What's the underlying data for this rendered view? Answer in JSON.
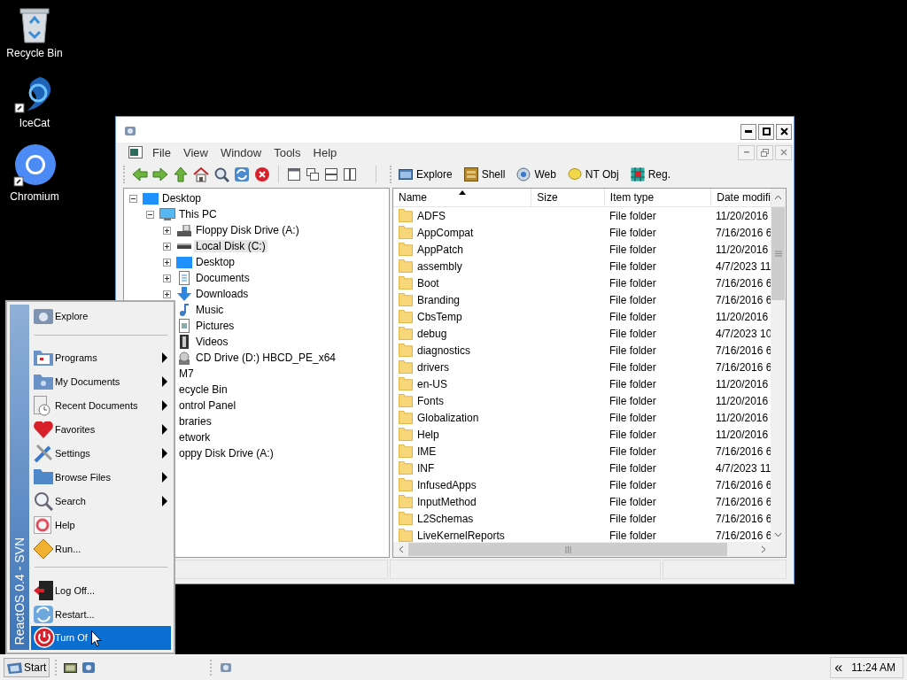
{
  "desktop_icons": [
    {
      "label": "Recycle Bin",
      "kind": "recycle"
    },
    {
      "label": "IceCat",
      "kind": "icecat"
    },
    {
      "label": "Chromium",
      "kind": "chromium"
    }
  ],
  "window": {
    "menu": [
      "File",
      "View",
      "Window",
      "Tools",
      "Help"
    ],
    "toolbar_buttons": [
      {
        "label": "Explore",
        "kind": "folder"
      },
      {
        "label": "Shell",
        "kind": "shell"
      },
      {
        "label": "Web",
        "kind": "web"
      },
      {
        "label": "NT Obj",
        "kind": "ntobj"
      },
      {
        "label": "Reg.",
        "kind": "registry"
      }
    ],
    "tree": {
      "items": [
        {
          "label": "Desktop",
          "kind": "desktop",
          "expanded": true,
          "selected": false,
          "children": [
            {
              "label": "This PC",
              "kind": "pc",
              "expanded": true,
              "selected": false,
              "children": [
                {
                  "label": "Floppy Disk Drive (A:)",
                  "kind": "floppy",
                  "expanded": false,
                  "selected": false
                },
                {
                  "label": "Local Disk (C:)",
                  "kind": "disk",
                  "expanded": false,
                  "selected": true
                },
                {
                  "label": "Desktop",
                  "kind": "desktop",
                  "expanded": false,
                  "selected": false
                },
                {
                  "label": "Documents",
                  "kind": "documents",
                  "expanded": false,
                  "selected": false
                },
                {
                  "label": "Downloads",
                  "kind": "downloads",
                  "expanded": false,
                  "selected": false
                },
                {
                  "label": "Music",
                  "kind": "music",
                  "selected": false
                },
                {
                  "label": "Pictures",
                  "kind": "pictures",
                  "selected": false
                },
                {
                  "label": "Videos",
                  "kind": "videos",
                  "selected": false
                },
                {
                  "label": "CD Drive (D:) HBCD_PE_x64",
                  "kind": "cd",
                  "selected": false
                }
              ]
            },
            {
              "label": "M7",
              "selected": false
            },
            {
              "label": "ecycle Bin",
              "selected": false
            },
            {
              "label": "ontrol Panel",
              "selected": false
            },
            {
              "label": "braries",
              "selected": false
            },
            {
              "label": "etwork",
              "selected": false
            },
            {
              "label": "oppy Disk Drive (A:)",
              "selected": false
            }
          ]
        }
      ]
    },
    "list": {
      "columns": [
        {
          "label": "Name",
          "sorted": true
        },
        {
          "label": "Size",
          "sorted": false
        },
        {
          "label": "Item type",
          "sorted": false
        },
        {
          "label": "Date modifi",
          "sorted": false
        }
      ],
      "rows": [
        {
          "name": "ADFS",
          "type": "File folder",
          "date": "11/20/2016"
        },
        {
          "name": "AppCompat",
          "type": "File folder",
          "date": "7/16/2016 6"
        },
        {
          "name": "AppPatch",
          "type": "File folder",
          "date": "11/20/2016"
        },
        {
          "name": "assembly",
          "type": "File folder",
          "date": "4/7/2023 11"
        },
        {
          "name": "Boot",
          "type": "File folder",
          "date": "7/16/2016 6"
        },
        {
          "name": "Branding",
          "type": "File folder",
          "date": "7/16/2016 6"
        },
        {
          "name": "CbsTemp",
          "type": "File folder",
          "date": "11/20/2016"
        },
        {
          "name": "debug",
          "type": "File folder",
          "date": "4/7/2023 10"
        },
        {
          "name": "diagnostics",
          "type": "File folder",
          "date": "7/16/2016 6"
        },
        {
          "name": "drivers",
          "type": "File folder",
          "date": "7/16/2016 6"
        },
        {
          "name": "en-US",
          "type": "File folder",
          "date": "11/20/2016"
        },
        {
          "name": "Fonts",
          "type": "File folder",
          "date": "11/20/2016"
        },
        {
          "name": "Globalization",
          "type": "File folder",
          "date": "11/20/2016"
        },
        {
          "name": "Help",
          "type": "File folder",
          "date": "11/20/2016"
        },
        {
          "name": "IME",
          "type": "File folder",
          "date": "7/16/2016 6"
        },
        {
          "name": "INF",
          "type": "File folder",
          "date": "4/7/2023 11"
        },
        {
          "name": "InfusedApps",
          "type": "File folder",
          "date": "7/16/2016 6"
        },
        {
          "name": "InputMethod",
          "type": "File folder",
          "date": "7/16/2016 6"
        },
        {
          "name": "L2Schemas",
          "type": "File folder",
          "date": "7/16/2016 6"
        },
        {
          "name": "LiveKernelReports",
          "type": "File folder",
          "date": "7/16/2016 6"
        }
      ]
    }
  },
  "start_menu": {
    "banner": "ReactOS 0.4 - SVN",
    "groups": [
      [
        {
          "label": "Explore",
          "kind": "explore",
          "submenu": false,
          "selected": false
        }
      ],
      [
        {
          "label": "Programs",
          "kind": "programs",
          "submenu": true,
          "selected": false
        },
        {
          "label": "My Documents",
          "kind": "mydocs",
          "submenu": true,
          "selected": false
        },
        {
          "label": "Recent Documents",
          "kind": "recent",
          "submenu": true,
          "selected": false
        },
        {
          "label": "Favorites",
          "kind": "favorites",
          "submenu": true,
          "selected": false
        },
        {
          "label": "Settings",
          "kind": "settings",
          "submenu": true,
          "selected": false
        },
        {
          "label": "Browse Files",
          "kind": "browse",
          "submenu": true,
          "selected": false
        },
        {
          "label": "Search",
          "kind": "search",
          "submenu": true,
          "selected": false
        },
        {
          "label": "Help",
          "kind": "help",
          "submenu": false,
          "selected": false
        },
        {
          "label": "Run...",
          "kind": "run",
          "submenu": false,
          "selected": false
        }
      ],
      [
        {
          "label": "Log Off...",
          "kind": "logoff",
          "submenu": false,
          "selected": false
        },
        {
          "label": "Restart...",
          "kind": "restart",
          "submenu": false,
          "selected": false
        },
        {
          "label": "Turn Of",
          "kind": "turnoff",
          "submenu": false,
          "selected": true
        }
      ]
    ]
  },
  "taskbar": {
    "start": "Start",
    "tray_toggle": "«",
    "clock": "11:24 AM"
  }
}
